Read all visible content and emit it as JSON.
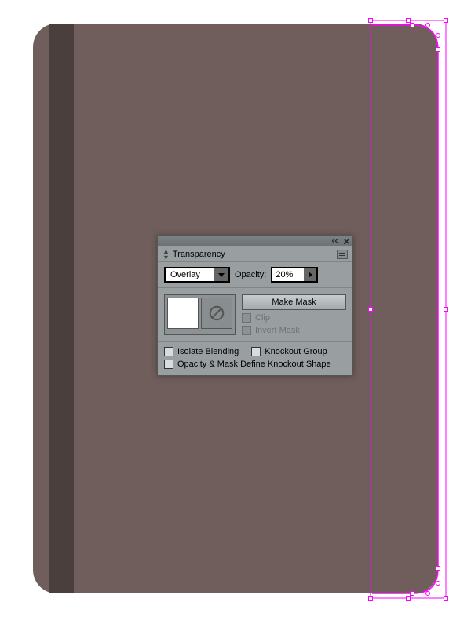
{
  "panel": {
    "title": "Transparency",
    "blendMode": "Overlay",
    "opacityLabel": "Opacity:",
    "opacityValue": "20%",
    "makeMask": "Make Mask",
    "clip": "Clip",
    "invertMask": "Invert Mask",
    "isolateBlending": "Isolate Blending",
    "knockoutGroup": "Knockout Group",
    "opacityMaskDefine": "Opacity & Mask Define Knockout Shape"
  }
}
